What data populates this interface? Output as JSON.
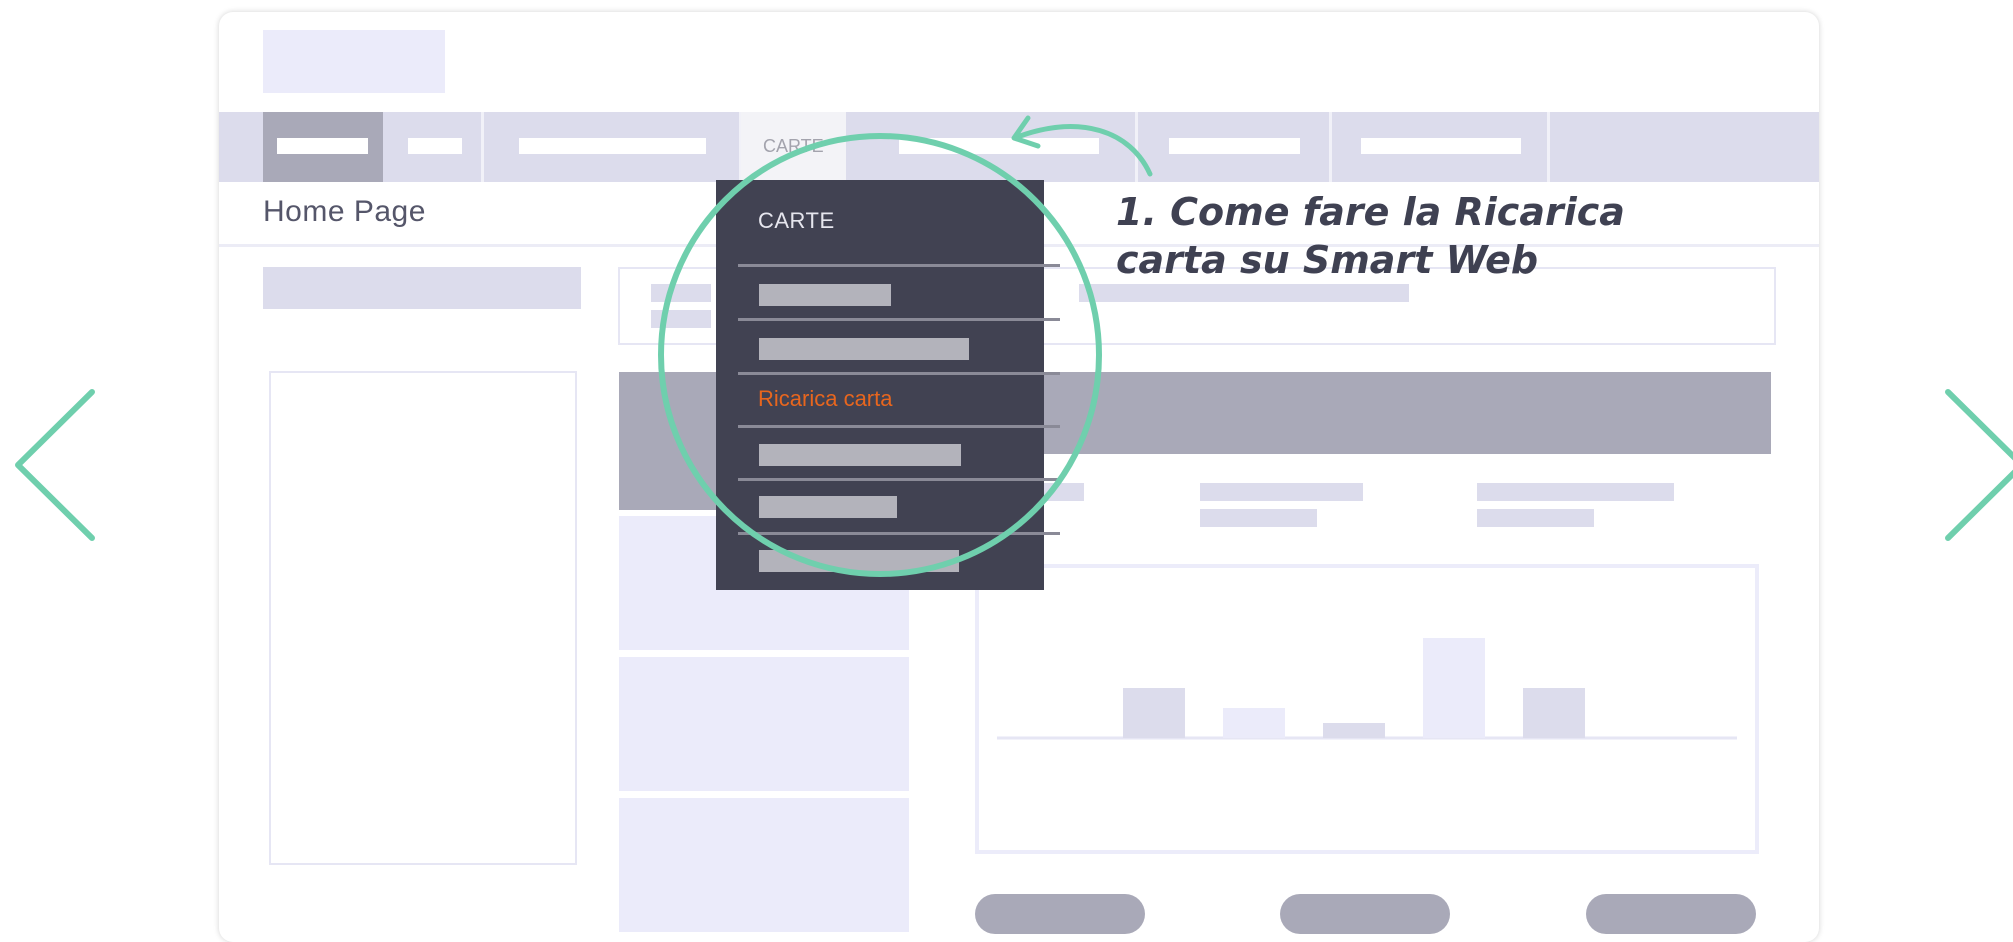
{
  "page": {
    "subtitle": "Home Page",
    "callout_line1": "1. Come fare la Ricarica",
    "callout_line2": "carta su Smart Web"
  },
  "navbar": {
    "tab_carte_label": "CARTE"
  },
  "dropdown": {
    "title": "CARTE",
    "active_item": "Ricarica carta"
  },
  "chart_data": {
    "type": "bar",
    "categories": [
      "",
      "",
      "",
      "",
      ""
    ],
    "values": [
      50,
      30,
      15,
      100,
      50
    ],
    "title": "",
    "xlabel": "",
    "ylabel": ""
  },
  "icons": {
    "prev": "chevron-left-icon",
    "next": "chevron-right-icon"
  },
  "colors": {
    "accent": "#6fcfad",
    "highlight": "#e8661e",
    "menu_bg": "#414252"
  }
}
